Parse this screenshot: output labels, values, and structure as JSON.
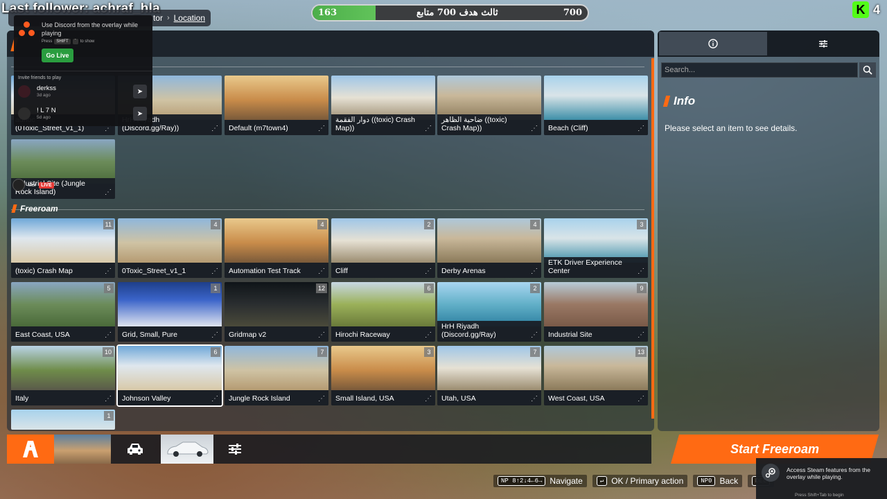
{
  "overlay": {
    "last_follower": "Last follower: achraf_hla",
    "goal": {
      "current": "163",
      "label": "ثالث هدف 700 متابع",
      "target": "700",
      "progress": 0.23
    },
    "kick_count": "4"
  },
  "breadcrumb": {
    "prev": "tor",
    "separator": "›",
    "current": "Location"
  },
  "discord": {
    "message": "Use Discord from the overlay while playing",
    "hint_press": "Press",
    "hint_key": "SHIFT",
    "hint_suffix": "to show",
    "go_live": "Go Live",
    "invite_label": "Invite friends to play",
    "friends": [
      {
        "name": "derkss",
        "ago": "3d ago"
      },
      {
        "name": "! L 7 N",
        "ago": "5d ago"
      }
    ]
  },
  "stream_live": {
    "name": "Mer",
    "badge": "LIVE"
  },
  "sections": {
    "first": {
      "tiles": [
        {
          "name": "adhoc (0Toxic_Street_v1_1)",
          "count": ""
        },
        {
          "name": "HrH Riyadh (Discord.gg/Ray))",
          "count": ""
        },
        {
          "name": "Default (m7town4)",
          "count": ""
        },
        {
          "name": "دوار الفقمة ((toxic) Crash Map))",
          "count": ""
        },
        {
          "name": "ضاحية الظاهر ((toxic) Crash Map))",
          "count": ""
        },
        {
          "name": "Beach (Cliff)",
          "count": ""
        },
        {
          "name": "Industrial Site (Jungle Rock Island)",
          "count": ""
        }
      ]
    },
    "freeroam": {
      "title": "Freeroam",
      "tiles": [
        {
          "name": "(toxic) Crash Map",
          "count": "11"
        },
        {
          "name": "0Toxic_Street_v1_1",
          "count": "4"
        },
        {
          "name": "Automation Test Track",
          "count": "4"
        },
        {
          "name": "Cliff",
          "count": "2"
        },
        {
          "name": "Derby Arenas",
          "count": "4"
        },
        {
          "name": "ETK Driver Experience Center",
          "count": "3"
        },
        {
          "name": "East Coast, USA",
          "count": "5"
        },
        {
          "name": "Grid, Small, Pure",
          "count": "1"
        },
        {
          "name": "Gridmap v2",
          "count": "12"
        },
        {
          "name": "Hirochi Raceway",
          "count": "6"
        },
        {
          "name": "HrH Riyadh (Discord.gg/Ray)",
          "count": "2"
        },
        {
          "name": "Industrial Site",
          "count": "9"
        },
        {
          "name": "Italy",
          "count": "10"
        },
        {
          "name": "Johnson Valley",
          "count": "6"
        },
        {
          "name": "Jungle Rock Island",
          "count": "7"
        },
        {
          "name": "Small Island, USA",
          "count": "3"
        },
        {
          "name": "Utah, USA",
          "count": "7"
        },
        {
          "name": "West Coast, USA",
          "count": "13"
        },
        {
          "name": "",
          "count": "1"
        }
      ]
    }
  },
  "info_panel": {
    "search_placeholder": "Search...",
    "title": "Info",
    "message": "Please select an item to see details."
  },
  "start_button": "Start Freeroam",
  "key_hints": {
    "navigate_keys": "NP 8↑2↓4←6→",
    "navigate": "Navigate",
    "ok_key": "↵",
    "ok": "OK / Primary action",
    "back_key": "NP0",
    "back": "Back",
    "del_key": "DEL"
  },
  "steam": {
    "text": "Access Steam features from the overlay while playing.",
    "sub": "Press Shift+Tab to begin"
  },
  "colors": {
    "accent": "#ff6a13",
    "goal_fill": "#4cae4a",
    "kick": "#53fc18"
  }
}
